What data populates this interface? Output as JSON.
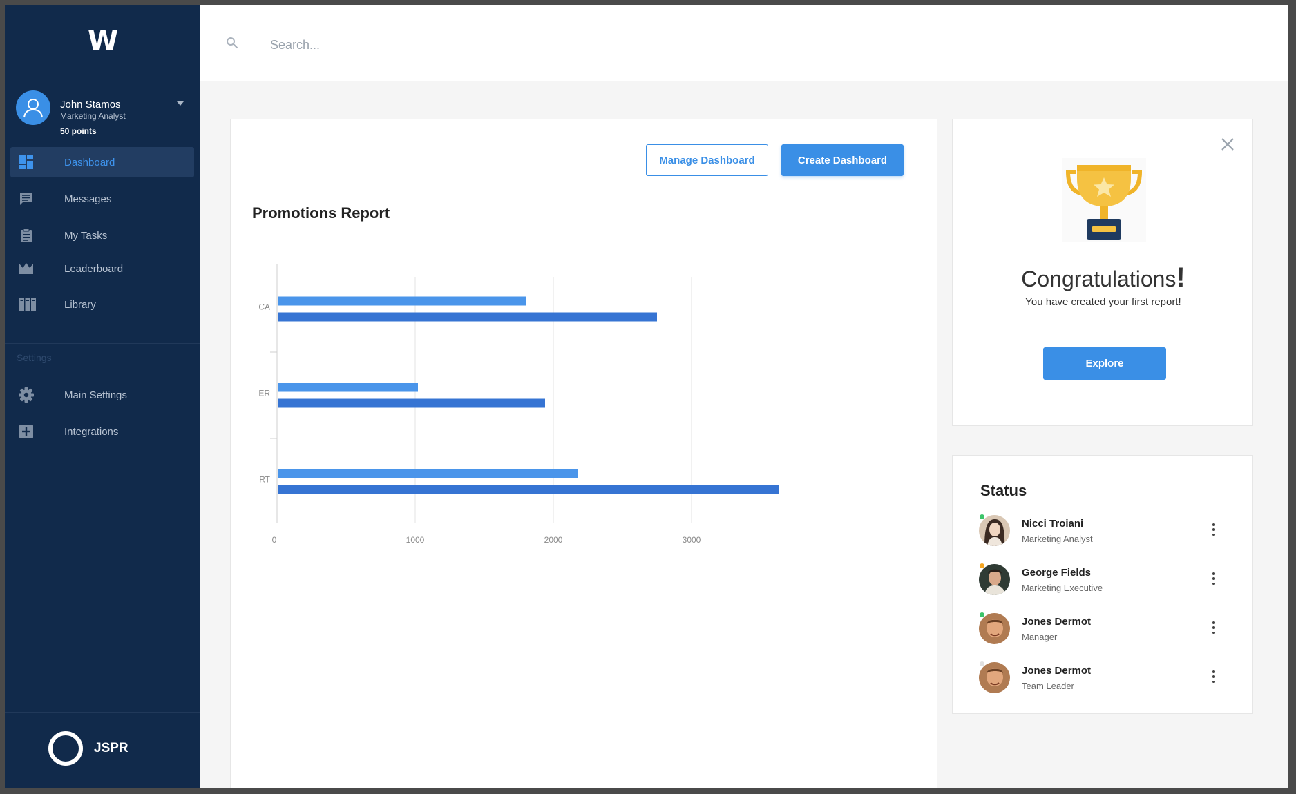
{
  "sidebar": {
    "logo": "W",
    "user": {
      "name": "John Stamos",
      "role": "Marketing Analyst",
      "points": "50 points"
    },
    "nav": [
      {
        "label": "Dashboard",
        "icon": "dashboard-icon",
        "active": true
      },
      {
        "label": "Messages",
        "icon": "messages-icon"
      },
      {
        "label": "My Tasks",
        "icon": "clipboard-icon"
      },
      {
        "label": "Leaderboard",
        "icon": "crown-icon"
      },
      {
        "label": "Library",
        "icon": "books-icon"
      }
    ],
    "settings_label": "Settings",
    "settings_nav": [
      {
        "label": "Main Settings",
        "icon": "gear-icon"
      },
      {
        "label": "Integrations",
        "icon": "plus-square-icon"
      }
    ],
    "brand": "JSPR"
  },
  "topbar": {
    "search_placeholder": "Search..."
  },
  "report": {
    "manage_label": "Manage Dashboard",
    "create_label": "Create Dashboard",
    "title": "Promotions Report"
  },
  "chart_data": {
    "type": "bar",
    "orientation": "horizontal",
    "categories": [
      "CA",
      "ER",
      "RT"
    ],
    "series": [
      {
        "values": [
          1800,
          1020,
          2180
        ],
        "color": "#4a95ea"
      },
      {
        "values": [
          2750,
          1940,
          3630
        ],
        "color": "#3674d3"
      }
    ],
    "xlim": [
      0,
      4000
    ],
    "x_ticks": [
      0,
      1000,
      2000,
      3000,
      4000
    ],
    "grid": "vertical"
  },
  "congrats": {
    "title": "Congratulations",
    "bang": "!",
    "subtitle": "You have created your first report!",
    "button": "Explore"
  },
  "status": {
    "title": "Status",
    "people": [
      {
        "name": "Nicci Troiani",
        "role": "Marketing Analyst",
        "dot": "#3cc46a"
      },
      {
        "name": "George Fields",
        "role": "Marketing Executive",
        "dot": "#f5a623"
      },
      {
        "name": "Jones Dermot",
        "role": "Manager",
        "dot": "#3cc46a"
      },
      {
        "name": "Jones Dermot",
        "role": "Team Leader",
        "dot": "#e0e0e0"
      }
    ]
  },
  "colors": {
    "sidebar": "#112a4b",
    "accent": "#3a8fe6"
  }
}
